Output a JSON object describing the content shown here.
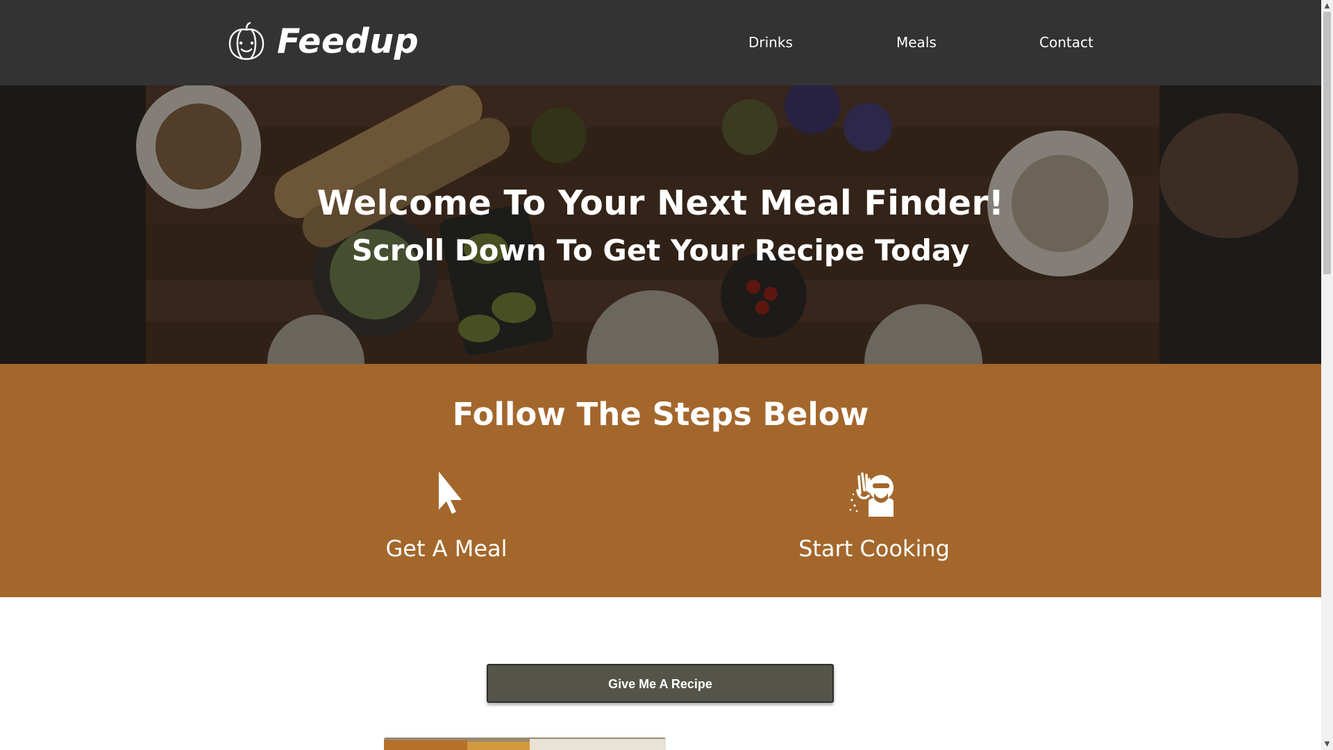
{
  "header": {
    "brand": "Feedup",
    "logo_icon": "pumpkin-icon",
    "nav": [
      {
        "label": "Drinks"
      },
      {
        "label": "Meals"
      },
      {
        "label": "Contact"
      }
    ],
    "background": "#333333"
  },
  "hero": {
    "title": "Welcome To Your Next Meal Finder!",
    "subtitle": "Scroll Down To Get Your Recipe Today"
  },
  "steps": {
    "title": "Follow The Steps Below",
    "background": "#a3672c",
    "items": [
      {
        "label": "Get A Meal",
        "icon": "cursor-pointer-icon"
      },
      {
        "label": "Start Cooking",
        "icon": "chef-kiss-icon"
      }
    ]
  },
  "action": {
    "button_label": "Give Me A Recipe",
    "button_color": "#54544a"
  }
}
